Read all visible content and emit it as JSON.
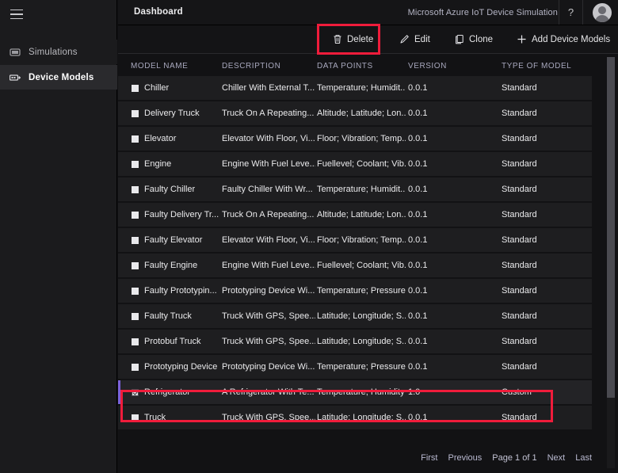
{
  "sidebar": {
    "menu_icon": "hamburger-icon",
    "items": [
      {
        "label": "Simulations",
        "icon": "monitor-icon",
        "active": false
      },
      {
        "label": "Device Models",
        "icon": "device-model-icon",
        "active": true
      }
    ]
  },
  "topbar": {
    "title": "Dashboard",
    "app_name": "Microsoft Azure IoT Device Simulation",
    "help_label": "?",
    "avatar": "user-avatar"
  },
  "toolbar": {
    "delete_label": "Delete",
    "edit_label": "Edit",
    "clone_label": "Clone",
    "add_label": "Add Device Models",
    "delete_icon": "trash-icon",
    "edit_icon": "pencil-icon",
    "clone_icon": "copy-icon",
    "add_icon": "plus-icon"
  },
  "table": {
    "columns": [
      {
        "label": "MODEL NAME"
      },
      {
        "label": "DESCRIPTION"
      },
      {
        "label": "DATA POINTS"
      },
      {
        "label": "VERSION"
      },
      {
        "label": "TYPE OF MODEL"
      }
    ],
    "rows": [
      {
        "name": "Chiller",
        "description": "Chiller With External T...",
        "data_points": "Temperature; Humidit...",
        "version": "0.0.1",
        "type": "Standard",
        "selected": false
      },
      {
        "name": "Delivery Truck",
        "description": "Truck On A Repeating...",
        "data_points": "Altitude; Latitude; Lon...",
        "version": "0.0.1",
        "type": "Standard",
        "selected": false
      },
      {
        "name": "Elevator",
        "description": "Elevator With Floor, Vi...",
        "data_points": "Floor; Vibration; Temp...",
        "version": "0.0.1",
        "type": "Standard",
        "selected": false
      },
      {
        "name": "Engine",
        "description": "Engine With Fuel Leve...",
        "data_points": "Fuellevel; Coolant; Vib...",
        "version": "0.0.1",
        "type": "Standard",
        "selected": false
      },
      {
        "name": "Faulty Chiller",
        "description": "Faulty Chiller With Wr...",
        "data_points": "Temperature; Humidit...",
        "version": "0.0.1",
        "type": "Standard",
        "selected": false
      },
      {
        "name": "Faulty Delivery Tr...",
        "description": "Truck On A Repeating...",
        "data_points": "Altitude; Latitude; Lon...",
        "version": "0.0.1",
        "type": "Standard",
        "selected": false
      },
      {
        "name": "Faulty Elevator",
        "description": "Elevator With Floor, Vi...",
        "data_points": "Floor; Vibration; Temp...",
        "version": "0.0.1",
        "type": "Standard",
        "selected": false
      },
      {
        "name": "Faulty Engine",
        "description": "Engine With Fuel Leve...",
        "data_points": "Fuellevel; Coolant; Vib...",
        "version": "0.0.1",
        "type": "Standard",
        "selected": false
      },
      {
        "name": "Faulty Prototypin...",
        "description": "Prototyping Device Wi...",
        "data_points": "Temperature; Pressure...",
        "version": "0.0.1",
        "type": "Standard",
        "selected": false
      },
      {
        "name": "Faulty Truck",
        "description": "Truck With GPS, Spee...",
        "data_points": "Latitude; Longitude; S...",
        "version": "0.0.1",
        "type": "Standard",
        "selected": false
      },
      {
        "name": "Protobuf Truck",
        "description": "Truck With GPS, Spee...",
        "data_points": "Latitude; Longitude; S...",
        "version": "0.0.1",
        "type": "Standard",
        "selected": false
      },
      {
        "name": "Prototyping Device",
        "description": "Prototyping Device Wi...",
        "data_points": "Temperature; Pressure...",
        "version": "0.0.1",
        "type": "Standard",
        "selected": false
      },
      {
        "name": "Refrigerator",
        "description": "A Refrigerator With Te...",
        "data_points": "Temperature; Humidity",
        "version": "1.0",
        "type": "Custom",
        "selected": true
      },
      {
        "name": "Truck",
        "description": "Truck With GPS, Spee...",
        "data_points": "Latitude; Longitude; S...",
        "version": "0.0.1",
        "type": "Standard",
        "selected": false
      }
    ]
  },
  "pagination": {
    "first": "First",
    "previous": "Previous",
    "page_info": "Page 1 of 1",
    "next": "Next",
    "last": "Last"
  },
  "annotations": {
    "highlight_color": "#f01c3b",
    "boxes": [
      "delete-button",
      "refrigerator-row"
    ]
  },
  "colors": {
    "accent_selected": "#7b61d9",
    "background": "#121214",
    "sidebar": "#1b1b1d",
    "row": "#1e1e20"
  }
}
